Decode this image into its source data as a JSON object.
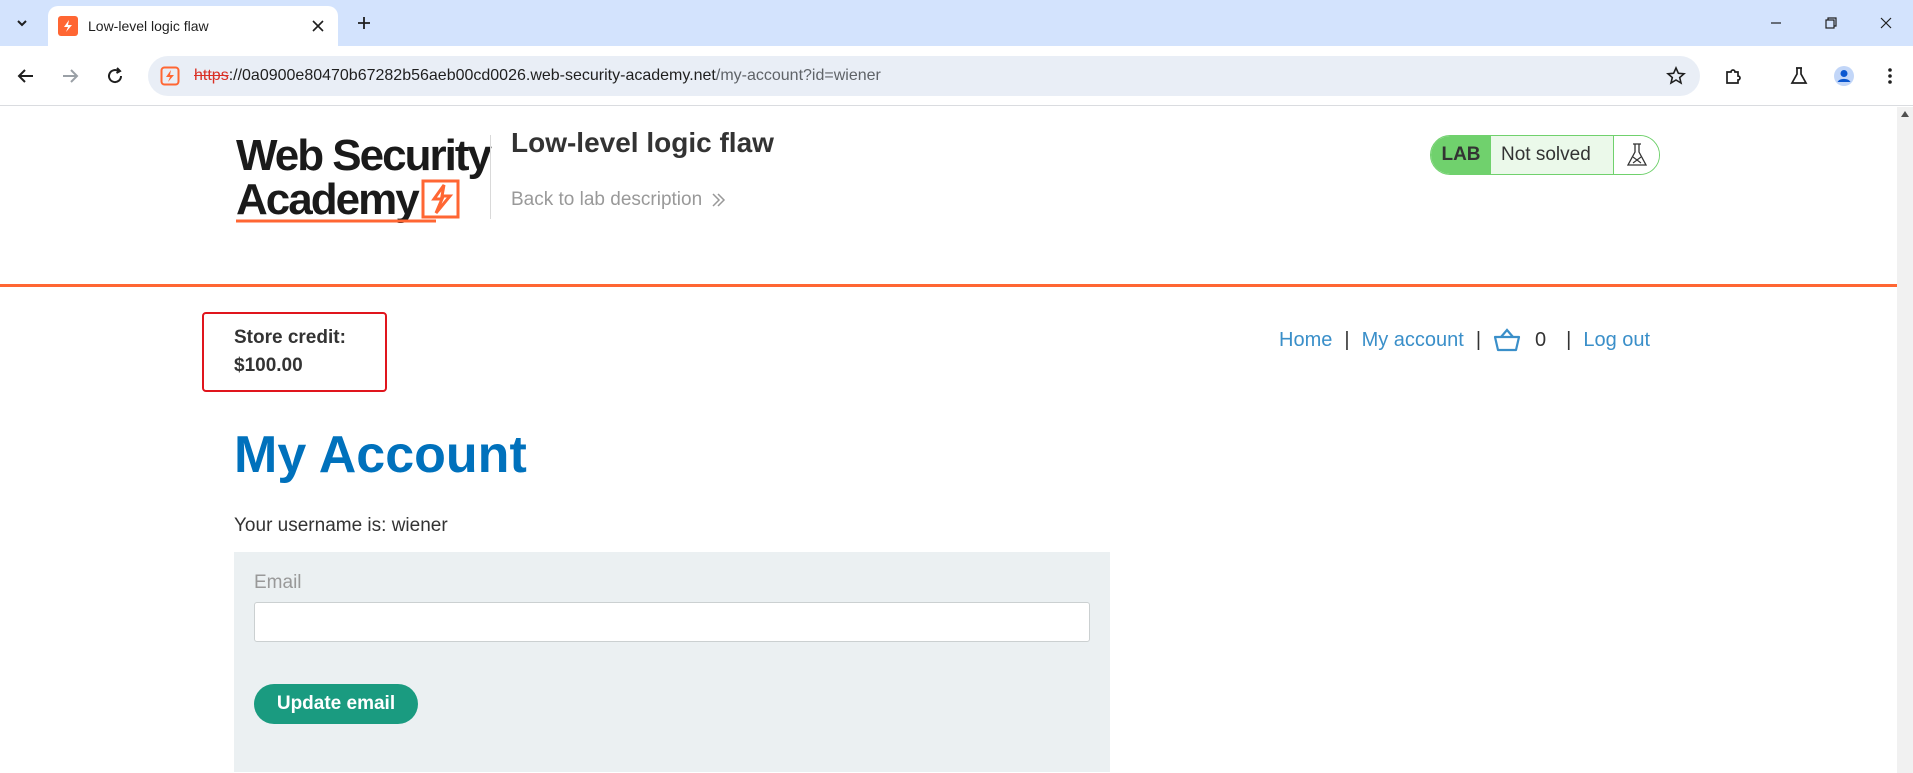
{
  "browser": {
    "tab": {
      "title": "Low-level logic flaw"
    },
    "url": {
      "scheme": "https",
      "host": "://0a0900e80470b67282b56aeb00cd0026.web-security-academy.net",
      "path": "/my-account?id=wiener"
    }
  },
  "header": {
    "logo_line1": "Web Security",
    "logo_line2": "Academy",
    "lab_title": "Low-level logic flaw",
    "back_link": "Back to lab description",
    "lab_badge": "LAB",
    "lab_status": "Not solved"
  },
  "account": {
    "credit_label": "Store credit:",
    "credit_value": "$100.00"
  },
  "nav": {
    "home": "Home",
    "separator": "|",
    "my_account": "My account",
    "cart_count": "0",
    "log_out": "Log out"
  },
  "main": {
    "heading": "My Account",
    "username_text": "Your username is: wiener",
    "email_label": "Email",
    "email_value": "",
    "update_button": "Update email"
  },
  "colors": {
    "accent_orange": "#ff6633",
    "heading_blue": "#0071bc",
    "link_blue": "#3a8fc9",
    "button_green": "#1a9b80",
    "lab_green": "#70d16d",
    "highlight_red": "#e0151d"
  }
}
